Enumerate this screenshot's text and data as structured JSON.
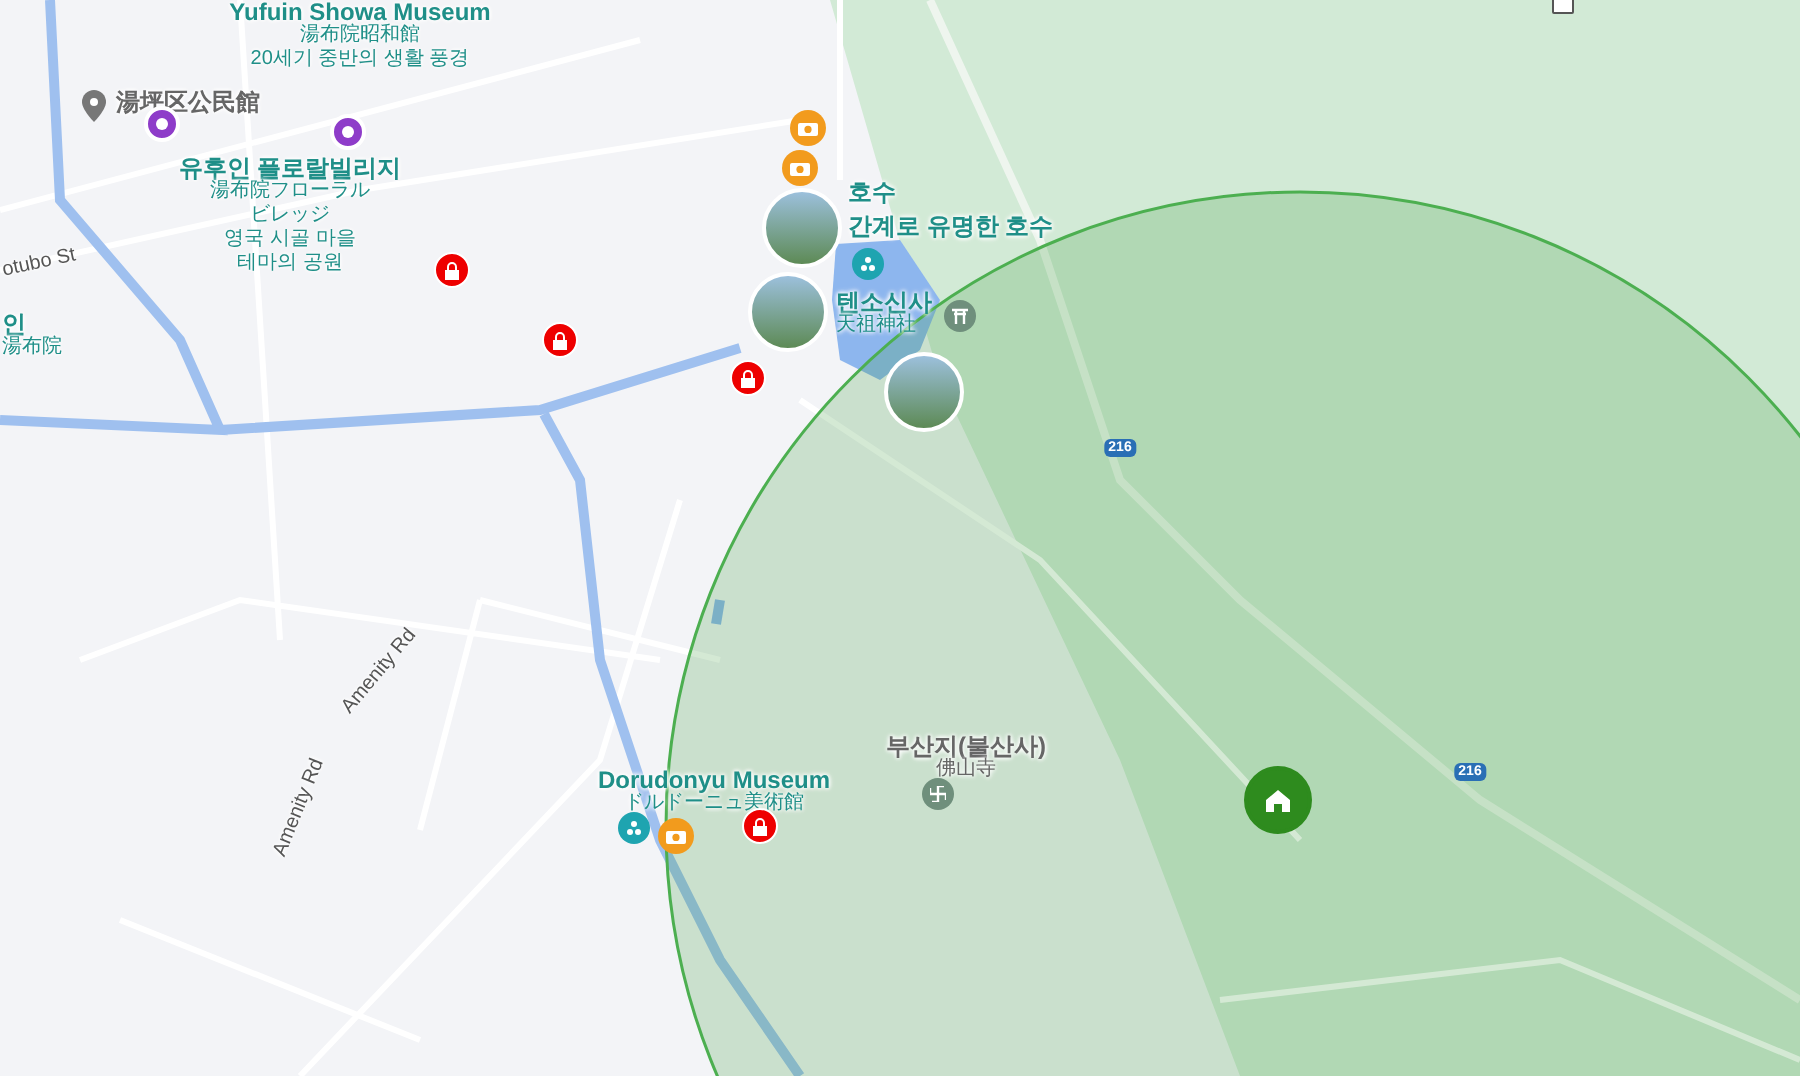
{
  "map": {
    "labels": [
      {
        "kind": "poi",
        "lines": [
          "Yufuin Showa Museum",
          "湯布院昭和館",
          "20세기 중반의 생활 풍경"
        ]
      },
      {
        "kind": "plain",
        "lines": [
          "湯坪区公民館"
        ]
      },
      {
        "kind": "poi",
        "lines": [
          "유후인 플로랄빌리지",
          "湯布院フローラル",
          "ビレッジ",
          "영국 시골 마을",
          "테마의 공원"
        ]
      },
      {
        "kind": "street",
        "lines": [
          "otubo St"
        ]
      },
      {
        "kind": "poi",
        "lines": [
          "인",
          "湯布院"
        ]
      },
      {
        "kind": "poi",
        "lines": [
          "호수"
        ]
      },
      {
        "kind": "poi",
        "lines": [
          "간계로 유명한 호수"
        ]
      },
      {
        "kind": "poi",
        "lines": [
          "텐소신사",
          "天祖神社"
        ]
      },
      {
        "kind": "poi",
        "lines": [
          "Dorudonyu Museum",
          "ドルドーニュ美術館"
        ]
      },
      {
        "kind": "plain",
        "lines": [
          "부산지(불산사)",
          "佛山寺"
        ]
      },
      {
        "kind": "street",
        "lines": [
          "Amenity Rd"
        ]
      },
      {
        "kind": "street",
        "lines": [
          "Amenity Rd"
        ]
      }
    ],
    "route_shields": [
      "216",
      "216"
    ],
    "markers": [
      {
        "kind": "pin"
      },
      {
        "kind": "purple"
      },
      {
        "kind": "purple"
      },
      {
        "kind": "lodging"
      },
      {
        "kind": "lodging"
      },
      {
        "kind": "lodging"
      },
      {
        "kind": "lodging"
      },
      {
        "kind": "camera"
      },
      {
        "kind": "camera"
      },
      {
        "kind": "camera"
      },
      {
        "kind": "park"
      },
      {
        "kind": "park"
      },
      {
        "kind": "shrine"
      },
      {
        "kind": "temple"
      },
      {
        "kind": "photo"
      },
      {
        "kind": "photo"
      },
      {
        "kind": "photo"
      },
      {
        "kind": "home"
      }
    ],
    "layer_toggle": {
      "checked": false
    }
  }
}
